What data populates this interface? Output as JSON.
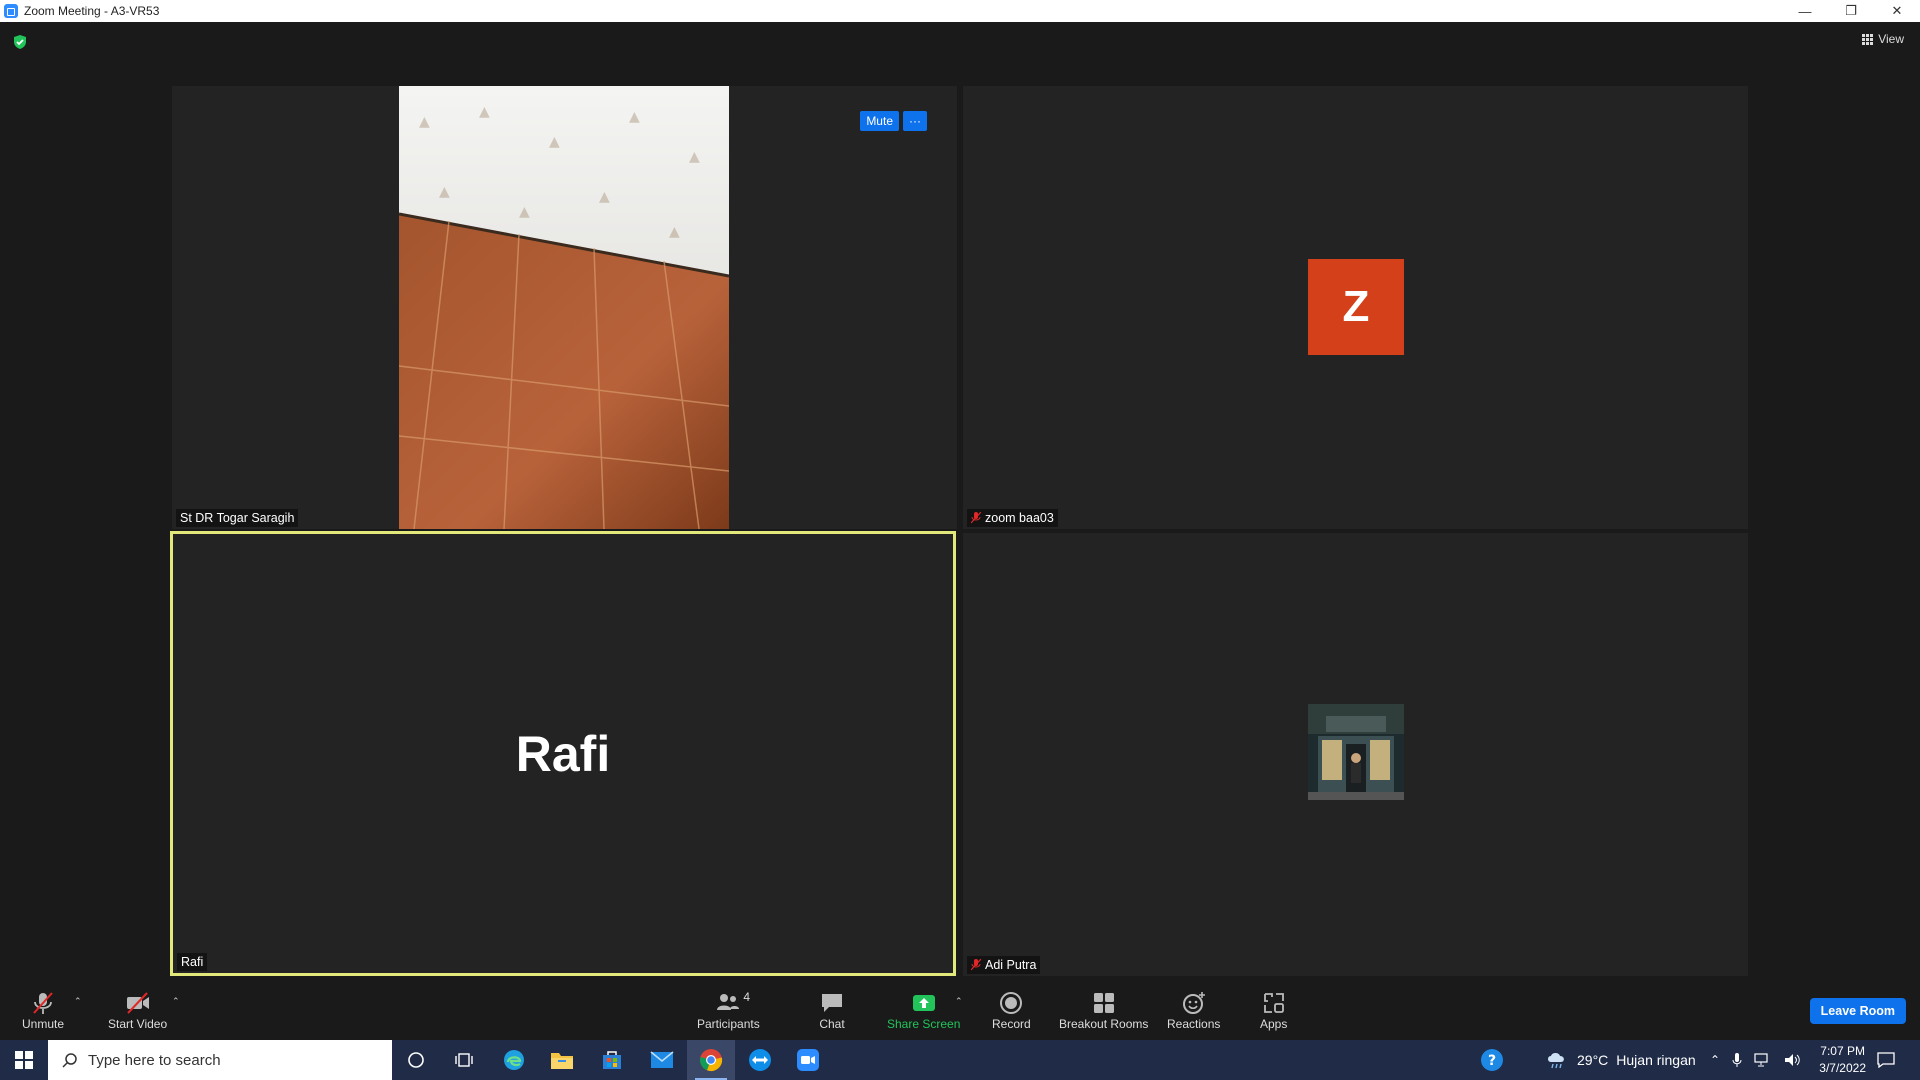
{
  "window": {
    "title": "Zoom Meeting - A3-VR53",
    "controls": [
      "minimize",
      "restore",
      "close"
    ]
  },
  "header": {
    "view_label": "View",
    "security_icon": "shield-check-icon"
  },
  "tiles": [
    {
      "name": "St DR Togar Saragih",
      "muted": false,
      "content": "video",
      "mute_label": "Mute",
      "more_label": "···"
    },
    {
      "name": "zoom baa03",
      "muted": true,
      "content": "avatar",
      "avatar_letter": "Z",
      "avatar_color": "#d4401a"
    },
    {
      "name": "Rafi",
      "muted": false,
      "content": "name",
      "display_name": "Rafi",
      "active_speaker": true
    },
    {
      "name": "Adi Putra",
      "muted": true,
      "content": "photo"
    }
  ],
  "toolbar": {
    "unmute": "Unmute",
    "start_video": "Start Video",
    "participants": "Participants",
    "participants_count": "4",
    "chat": "Chat",
    "share_screen": "Share Screen",
    "record": "Record",
    "breakout_rooms": "Breakout Rooms",
    "reactions": "Reactions",
    "apps": "Apps",
    "leave": "Leave Room"
  },
  "taskbar": {
    "search_placeholder": "Type here to search",
    "weather_temp": "29°C",
    "weather_desc": "Hujan ringan",
    "time": "7:07 PM",
    "date": "3/7/2022",
    "apps": [
      "cortana-icon",
      "task-view-icon",
      "edge-icon",
      "file-explorer-icon",
      "store-icon",
      "mail-icon",
      "chrome-icon",
      "teamviewer-icon",
      "zoom-icon"
    ]
  },
  "colors": {
    "accent": "#0e72ed",
    "active_speaker_border": "#e3e87a",
    "share_green": "#22c35a",
    "muted_red": "#e02828"
  }
}
